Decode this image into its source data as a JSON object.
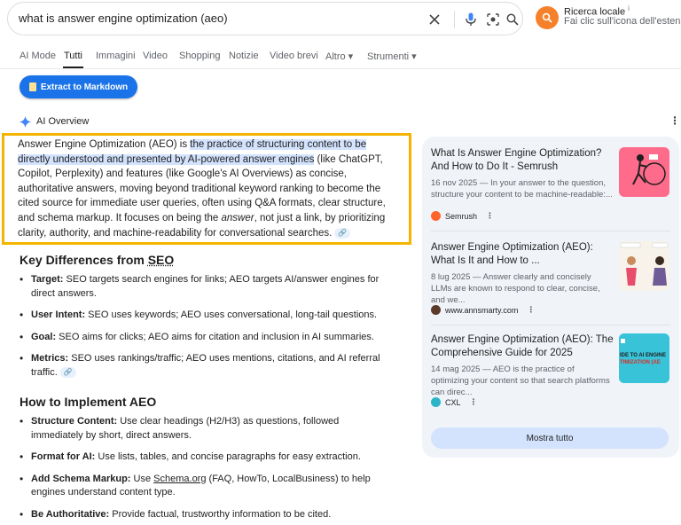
{
  "search": {
    "query": "what is answer engine optimization (aeo)",
    "icons": [
      "close-icon",
      "mic-icon",
      "lens-icon",
      "search-icon"
    ]
  },
  "local": {
    "title": "Ricerca locale",
    "info_mark": "i",
    "subtitle": "Fai clic sull'icona dell'estensione p",
    "badge_color": "#f5822a"
  },
  "tabs": [
    {
      "label": "AI Mode"
    },
    {
      "label": "Tutti"
    },
    {
      "label": "Immagini"
    },
    {
      "label": "Video"
    },
    {
      "label": "Shopping"
    },
    {
      "label": "Notizie"
    },
    {
      "label": "Video brevi"
    },
    {
      "label": "Altro ▾"
    },
    {
      "label": "Strumenti ▾"
    }
  ],
  "extract_button": "Extract to Markdown",
  "ai_overview": {
    "label": "AI Overview",
    "p1": "Answer Engine Optimization (AEO) is ",
    "highlight": "the practice of structuring content to be directly understood and presented by AI-powered answer engines",
    "p2": " (like ChatGPT, Copilot, Perplexity) and features (like Google's AI Overviews) as concise, authoritative answers, moving beyond traditional keyword ranking to become the cited source for immediate user queries, often using Q&A formats, clear structure, and schema markup. It focuses on being the ",
    "em": "answer",
    "p3": ", not just a link, by prioritizing clarity, authority, and machine-readability for conversational searches."
  },
  "section1": {
    "title_prefix": "Key Differences from ",
    "title_link": "SEO",
    "items": [
      {
        "bold": "Target:",
        "text": " SEO targets search engines for links; AEO targets AI/answer engines for direct answers."
      },
      {
        "bold": "User Intent:",
        "text": " SEO uses keywords; AEO uses conversational, long-tail questions."
      },
      {
        "bold": "Goal:",
        "text": " SEO aims for clicks; AEO aims for citation and inclusion in AI summaries."
      },
      {
        "bold": "Metrics:",
        "text": " SEO uses rankings/traffic; AEO uses mentions, citations, and AI referral traffic."
      }
    ]
  },
  "section2": {
    "title": "How to Implement AEO",
    "items": [
      {
        "bold": "Structure Content:",
        "text": " Use clear headings (H2/H3) as questions, followed immediately by short, direct answers."
      },
      {
        "bold": "Format for AI:",
        "text": " Use lists, tables, and concise paragraphs for easy extraction."
      },
      {
        "bold": "Add Schema Markup:",
        "pre": " Use ",
        "link": "Schema.org",
        "text": " (FAQ, HowTo, LocalBusiness) to help engines understand content type."
      },
      {
        "bold": "Be Authoritative:",
        "text": " Provide factual, trustworthy information to be cited."
      }
    ]
  },
  "sources": [
    {
      "title": "What Is Answer Engine Optimization? And How to Do It - Semrush",
      "snippet": "16 nov 2025 — In your answer to the question, structure your content to be machine-readable:...",
      "site": "Semrush",
      "favicon_color": "#ff642d",
      "thumb_color": "#ff6b8a"
    },
    {
      "title": "Answer Engine Optimization (AEO): What Is It and How to ...",
      "snippet": "8 lug 2025 — Answer clearly and concisely LLMs are known to respond to clear, concise, and we...",
      "site": "www.annsmarty.com",
      "favicon_color": "#5b3a29",
      "thumb_color": "#f7f3ea"
    },
    {
      "title": "Answer Engine Optimization (AEO): The Comprehensive Guide for 2025",
      "snippet": "14 mag 2025 — AEO is the practice of optimizing your content so that search platforms can direc...",
      "site": "CXL",
      "favicon_color": "#2ab5c8",
      "thumb_color": "#39c3d8",
      "thumb_text1": "IDE TO AI ENGINE",
      "thumb_text2": "TIMIZATION (AE"
    }
  ],
  "show_all": "Mostra tutto"
}
